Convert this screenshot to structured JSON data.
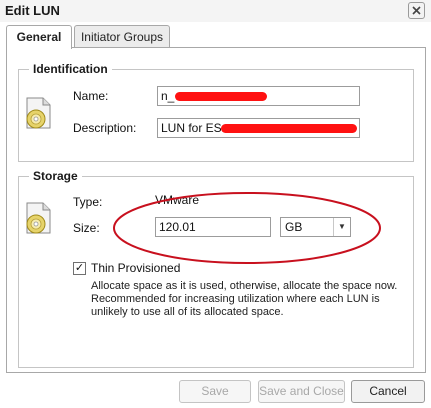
{
  "window": {
    "title": "Edit LUN"
  },
  "tabs": [
    {
      "label": "General",
      "active": true
    },
    {
      "label": "Initiator Groups",
      "active": false
    }
  ],
  "identification": {
    "legend": "Identification",
    "name_label": "Name:",
    "name_value": "n_",
    "description_label": "Description:",
    "description_value": "LUN for ES"
  },
  "storage": {
    "legend": "Storage",
    "type_label": "Type:",
    "type_value": "VMware",
    "size_label": "Size:",
    "size_value": "120.01",
    "unit_value": "GB",
    "thin_label": "Thin Provisioned",
    "thin_checked": true,
    "thin_description_lines": [
      "Allocate space as it is used, otherwise, allocate the space now.",
      "Recommended for increasing utilization where each LUN is",
      "unlikely to use all of its allocated space."
    ]
  },
  "buttons": {
    "save": "Save",
    "save_and_close": "Save and Close",
    "cancel": "Cancel"
  },
  "colors": {
    "annotation": "#c8101e",
    "redaction": "#ff1111"
  },
  "icons": {
    "close": "close-icon",
    "disk": "disk-icon",
    "dropdown": "chevron-down-icon",
    "check": "check-icon"
  }
}
